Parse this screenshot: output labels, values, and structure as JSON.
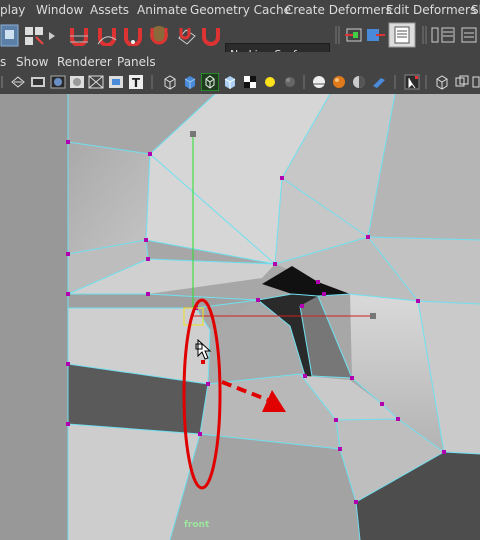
{
  "menu": {
    "items": [
      "play",
      "Window",
      "Assets",
      "Animate",
      "Geometry Cache",
      "Create Deformers",
      "Edit Deformers",
      "Sk"
    ]
  },
  "toolbar": {
    "live_surface_label": "No Live Surface"
  },
  "panel_menu": {
    "items": [
      "s",
      "Show",
      "Renderer",
      "Panels"
    ]
  },
  "viewport": {
    "camera_label": "front",
    "wire_color": "#6fe0f0",
    "vertex_color": "#b000b0",
    "annotation_color": "#e00000",
    "y_axis_color": "#2adf2a",
    "x_axis_color": "#d02020"
  }
}
